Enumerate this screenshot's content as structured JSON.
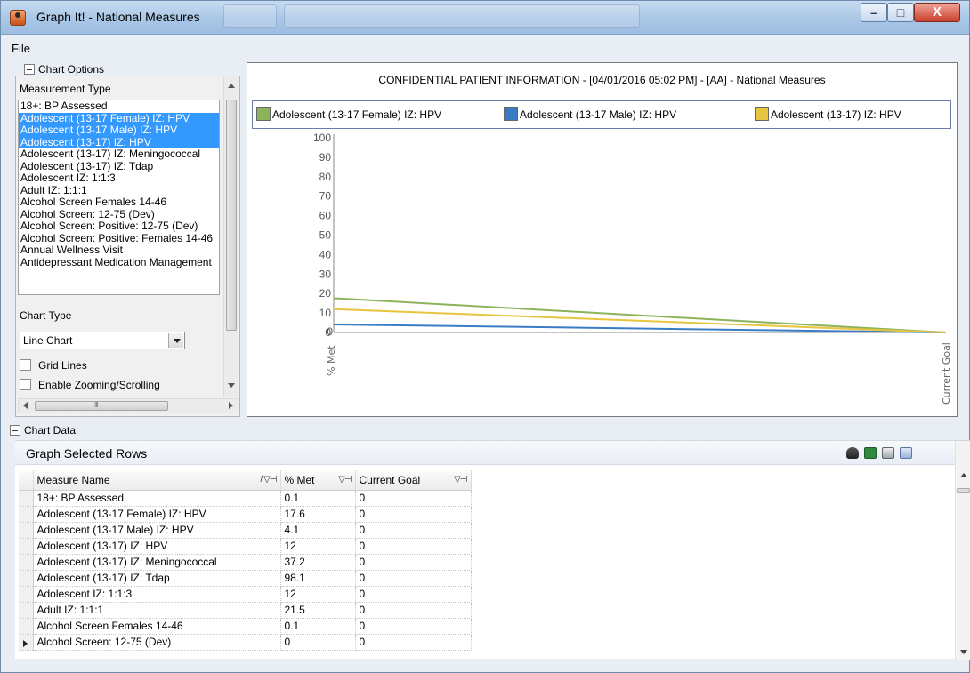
{
  "window": {
    "title": "Graph It! - National Measures",
    "minimize": "–",
    "maximize": "□",
    "close": "X"
  },
  "menu": {
    "file": "File"
  },
  "chart_options": {
    "header": "Chart Options",
    "measurement_type_label": "Measurement Type",
    "measurement_types": [
      {
        "label": "18+: BP Assessed",
        "selected": false
      },
      {
        "label": "Adolescent (13-17 Female) IZ: HPV",
        "selected": true
      },
      {
        "label": "Adolescent (13-17 Male) IZ: HPV",
        "selected": true
      },
      {
        "label": "Adolescent (13-17) IZ: HPV",
        "selected": true
      },
      {
        "label": "Adolescent (13-17) IZ: Meningococcal",
        "selected": false
      },
      {
        "label": "Adolescent (13-17) IZ: Tdap",
        "selected": false
      },
      {
        "label": "Adolescent IZ: 1:1:3",
        "selected": false
      },
      {
        "label": "Adult IZ: 1:1:1",
        "selected": false
      },
      {
        "label": "Alcohol Screen Females 14-46",
        "selected": false
      },
      {
        "label": "Alcohol Screen: 12-75 (Dev)",
        "selected": false
      },
      {
        "label": "Alcohol Screen: Positive: 12-75 (Dev)",
        "selected": false
      },
      {
        "label": "Alcohol Screen: Positive: Females 14-46",
        "selected": false
      },
      {
        "label": "Annual Wellness Visit",
        "selected": false
      },
      {
        "label": "Antidepressant Medication Management",
        "selected": false
      }
    ],
    "chart_type_label": "Chart Type",
    "chart_type_value": "Line Chart",
    "grid_lines_label": "Grid Lines",
    "zoom_label": "Enable Zooming/Scrolling"
  },
  "chart_data": {
    "type": "line",
    "title": "CONFIDENTIAL PATIENT INFORMATION - [04/01/2016 05:02 PM] - [AA] - National Measures",
    "categories": [
      "% Met",
      "Current Goal"
    ],
    "ylim": [
      0,
      100
    ],
    "yticks": [
      "100",
      "90",
      "80",
      "70",
      "60",
      "50",
      "40",
      "30",
      "20",
      "10",
      "0",
      "0"
    ],
    "legend_position": "top",
    "grid": false,
    "series": [
      {
        "name": "Adolescent (13-17 Female) IZ: HPV",
        "values": [
          17.6,
          0
        ],
        "color": "#8db35a"
      },
      {
        "name": "Adolescent (13-17 Male) IZ: HPV",
        "values": [
          4.1,
          0
        ],
        "color": "#3a7cc4"
      },
      {
        "name": "Adolescent (13-17) IZ: HPV",
        "values": [
          12,
          0
        ],
        "color": "#e8c53e"
      }
    ]
  },
  "chart_data_section": {
    "header": "Chart Data",
    "caption": "Graph Selected Rows",
    "columns": [
      "Measure Name",
      "% Met",
      "Current Goal"
    ],
    "rows": [
      [
        "18+: BP Assessed",
        "0.1",
        "0"
      ],
      [
        "Adolescent (13-17 Female) IZ: HPV",
        "17.6",
        "0"
      ],
      [
        "Adolescent (13-17 Male) IZ: HPV",
        "4.1",
        "0"
      ],
      [
        "Adolescent (13-17) IZ: HPV",
        "12",
        "0"
      ],
      [
        "Adolescent (13-17) IZ: Meningococcal",
        "37.2",
        "0"
      ],
      [
        "Adolescent (13-17) IZ: Tdap",
        "98.1",
        "0"
      ],
      [
        "Adolescent IZ: 1:1:3",
        "12",
        "0"
      ],
      [
        "Adult IZ: 1:1:1",
        "21.5",
        "0"
      ],
      [
        "Alcohol Screen Females 14-46",
        "0.1",
        "0"
      ],
      [
        "Alcohol Screen: 12-75 (Dev)",
        "0",
        "0"
      ]
    ],
    "icons": [
      "binoculars-icon",
      "excel-export-icon",
      "print-icon",
      "copy-icon"
    ]
  }
}
